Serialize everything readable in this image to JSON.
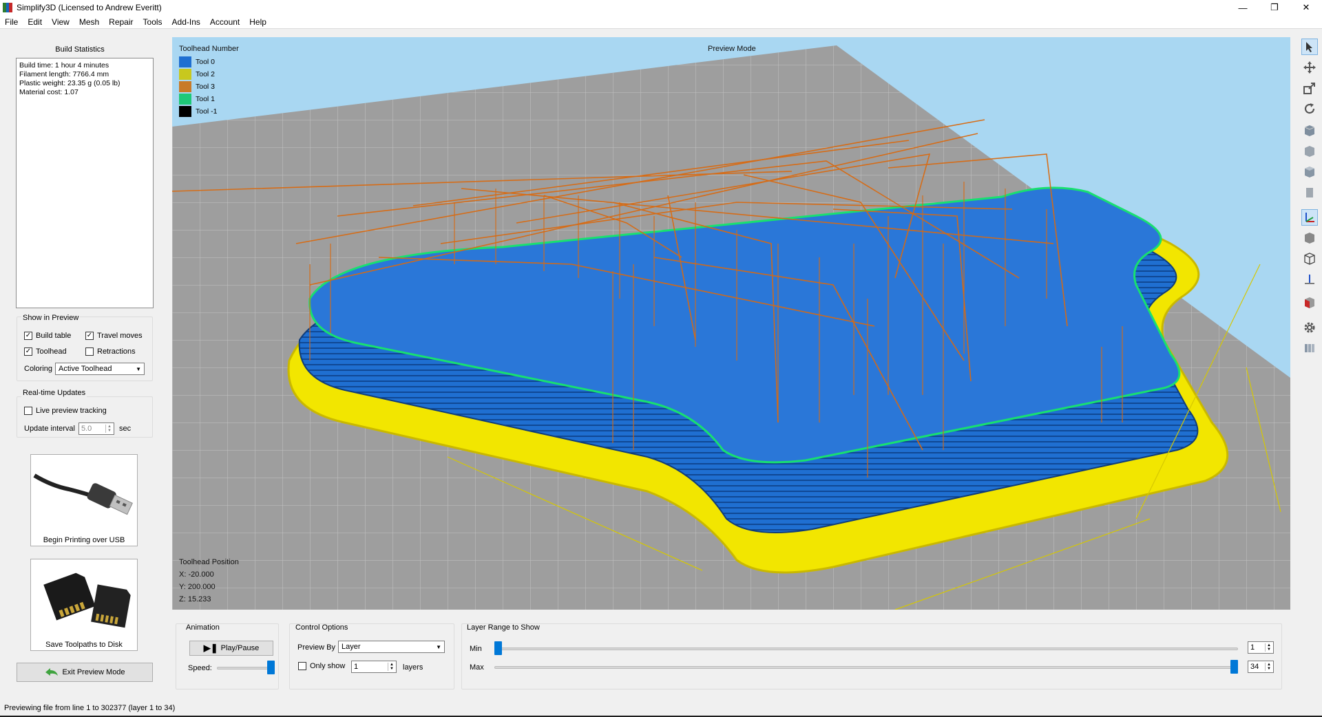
{
  "window": {
    "title": "Simplify3D (Licensed to Andrew Everitt)",
    "minimize": "—",
    "maximize": "❐",
    "close": "✕"
  },
  "menu": [
    "File",
    "Edit",
    "View",
    "Mesh",
    "Repair",
    "Tools",
    "Add-Ins",
    "Account",
    "Help"
  ],
  "build_statistics": {
    "title": "Build Statistics",
    "lines": [
      "Build time: 1 hour 4 minutes",
      "Filament length: 7766.4 mm",
      "Plastic weight: 23.35 g (0.05 lb)",
      "Material cost: 1.07"
    ]
  },
  "show_in_preview": {
    "title": "Show in Preview",
    "build_table": {
      "label": "Build table",
      "checked": true
    },
    "travel_moves": {
      "label": "Travel moves",
      "checked": true
    },
    "toolhead": {
      "label": "Toolhead",
      "checked": true
    },
    "retractions": {
      "label": "Retractions",
      "checked": false
    },
    "coloring_label": "Coloring",
    "coloring_value": "Active Toolhead"
  },
  "realtime": {
    "title": "Real-time Updates",
    "live_tracking": {
      "label": "Live preview tracking",
      "checked": false
    },
    "interval_label": "Update interval",
    "interval_value": "5.0",
    "interval_unit": "sec"
  },
  "usb_button": {
    "label": "Begin Printing over USB",
    "icon": "usb-cable-icon"
  },
  "disk_button": {
    "label": "Save Toolpaths to Disk",
    "icon": "sd-card-icon"
  },
  "exit_button": {
    "label": "Exit Preview Mode",
    "icon": "back-arrow-icon"
  },
  "viewport": {
    "mode_label": "Preview Mode",
    "legend_title": "Toolhead Number",
    "legend": [
      {
        "label": "Tool 0",
        "color": "#1f6fd1"
      },
      {
        "label": "Tool 2",
        "color": "#c8c81e"
      },
      {
        "label": "Tool 3",
        "color": "#c87a28"
      },
      {
        "label": "Tool 1",
        "color": "#1ec878"
      },
      {
        "label": "Tool -1",
        "color": "#000000"
      }
    ],
    "position_title": "Toolhead Position",
    "x": "X: -20.000",
    "y": "Y: 200.000",
    "z": "Z: 15.233"
  },
  "animation": {
    "title": "Animation",
    "play_label": "Play/Pause",
    "speed_label": "Speed:",
    "speed_fraction": 1.0
  },
  "control_options": {
    "title": "Control Options",
    "preview_by_label": "Preview By",
    "preview_by_value": "Layer",
    "only_show": {
      "label": "Only show",
      "checked": false
    },
    "only_show_value": "1",
    "layers_label": "layers"
  },
  "layer_range": {
    "title": "Layer Range to Show",
    "min_label": "Min",
    "max_label": "Max",
    "min_value": "1",
    "max_value": "34",
    "total_layers": 34
  },
  "status": "Previewing file from line 1 to 302377 (layer 1 to 34)",
  "toolbar_icons": [
    "select-arrow-icon",
    "move-icon",
    "scale-icon",
    "rotate-icon",
    "view-iso-icon",
    "view-front-icon",
    "view-top-icon",
    "view-side-icon",
    "axes-icon",
    "solid-view-icon",
    "wireframe-view-icon",
    "z-axis-icon",
    "section-view-icon",
    "settings-gear-icon",
    "layers-icon"
  ]
}
